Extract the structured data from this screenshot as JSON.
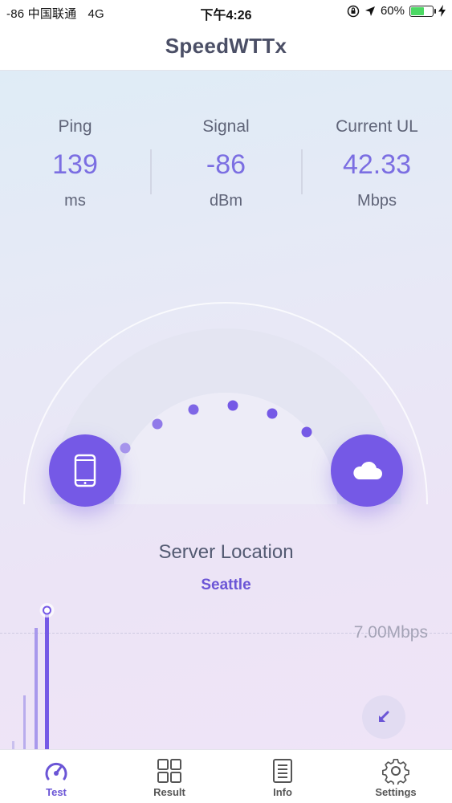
{
  "status_bar": {
    "carrier": "-86 中国联通",
    "network": "4G",
    "time": "下午4:26",
    "battery": "60%",
    "battery_level": 0.6
  },
  "header": {
    "title": "SpeedWTTx"
  },
  "stats": [
    {
      "label": "Ping",
      "value": "139",
      "unit": "ms"
    },
    {
      "label": "Signal",
      "value": "-86",
      "unit": "dBm"
    },
    {
      "label": "Current UL",
      "value": "42.33",
      "unit": "Mbps"
    }
  ],
  "gauge": {
    "left_icon": "phone-icon",
    "right_icon": "cloud-icon"
  },
  "server": {
    "title": "Server Location",
    "city": "Seattle"
  },
  "graph": {
    "speed_label": "7.00Mbps",
    "action_icon": "arrow-down-left-icon"
  },
  "tabs": [
    {
      "label": "Test",
      "icon": "speedometer-icon",
      "active": true
    },
    {
      "label": "Result",
      "icon": "grid-icon",
      "active": false
    },
    {
      "label": "Info",
      "icon": "document-icon",
      "active": false
    },
    {
      "label": "Settings",
      "icon": "gear-icon",
      "active": false
    }
  ],
  "colors": {
    "accent": "#7559e6",
    "value_text": "#7b6ee2",
    "city_text": "#6b55d6"
  }
}
